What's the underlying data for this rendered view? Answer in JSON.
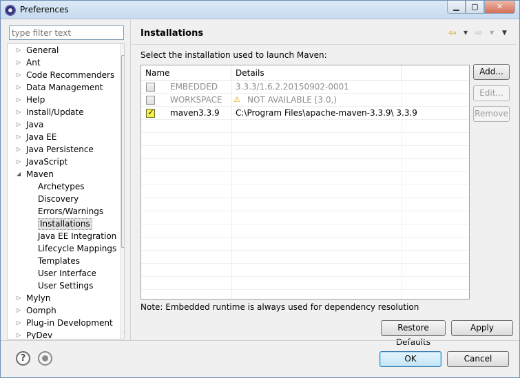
{
  "window": {
    "title": "Preferences"
  },
  "filter": {
    "placeholder": "type filter text"
  },
  "tree": {
    "items": [
      {
        "label": "General",
        "level": 0,
        "expander": "collapsed"
      },
      {
        "label": "Ant",
        "level": 0,
        "expander": "collapsed"
      },
      {
        "label": "Code Recommenders",
        "level": 0,
        "expander": "collapsed"
      },
      {
        "label": "Data Management",
        "level": 0,
        "expander": "collapsed"
      },
      {
        "label": "Help",
        "level": 0,
        "expander": "collapsed"
      },
      {
        "label": "Install/Update",
        "level": 0,
        "expander": "collapsed"
      },
      {
        "label": "Java",
        "level": 0,
        "expander": "collapsed"
      },
      {
        "label": "Java EE",
        "level": 0,
        "expander": "collapsed"
      },
      {
        "label": "Java Persistence",
        "level": 0,
        "expander": "collapsed"
      },
      {
        "label": "JavaScript",
        "level": 0,
        "expander": "collapsed"
      },
      {
        "label": "Maven",
        "level": 0,
        "expander": "expanded"
      },
      {
        "label": "Archetypes",
        "level": 1
      },
      {
        "label": "Discovery",
        "level": 1
      },
      {
        "label": "Errors/Warnings",
        "level": 1
      },
      {
        "label": "Installations",
        "level": 1,
        "selected": true
      },
      {
        "label": "Java EE Integration",
        "level": 1
      },
      {
        "label": "Lifecycle Mappings",
        "level": 1
      },
      {
        "label": "Templates",
        "level": 1
      },
      {
        "label": "User Interface",
        "level": 1
      },
      {
        "label": "User Settings",
        "level": 1
      },
      {
        "label": "Mylyn",
        "level": 0,
        "expander": "collapsed"
      },
      {
        "label": "Oomph",
        "level": 0,
        "expander": "collapsed"
      },
      {
        "label": "Plug-in Development",
        "level": 0,
        "expander": "collapsed"
      },
      {
        "label": "PyDev",
        "level": 0,
        "expander": "collapsed"
      }
    ]
  },
  "page": {
    "title": "Installations",
    "description": "Select the installation used to launch Maven:",
    "note": "Note: Embedded runtime is always used for dependency resolution"
  },
  "table": {
    "columns": [
      "Name",
      "Details"
    ],
    "rows": [
      {
        "name": "EMBEDDED",
        "details": "3.3.3/1.6.2.20150902-0001",
        "checked": false,
        "enabled": false,
        "warning": false
      },
      {
        "name": "WORKSPACE",
        "details": "NOT AVAILABLE [3.0,)",
        "checked": false,
        "enabled": false,
        "warning": true
      },
      {
        "name": "maven3.3.9",
        "details": "C:\\Program Files\\apache-maven-3.3.9\\ 3.3.9",
        "checked": true,
        "enabled": true,
        "warning": false
      }
    ]
  },
  "buttons": {
    "add": "Add...",
    "edit": "Edit...",
    "remove": "Remove",
    "restore_defaults": "Restore Defaults",
    "apply": "Apply",
    "ok": "OK",
    "cancel": "Cancel"
  },
  "colors": {
    "selection_check": "#f6f04a",
    "title_bar": "#c7daee",
    "ok_border": "#3c7fb1"
  }
}
